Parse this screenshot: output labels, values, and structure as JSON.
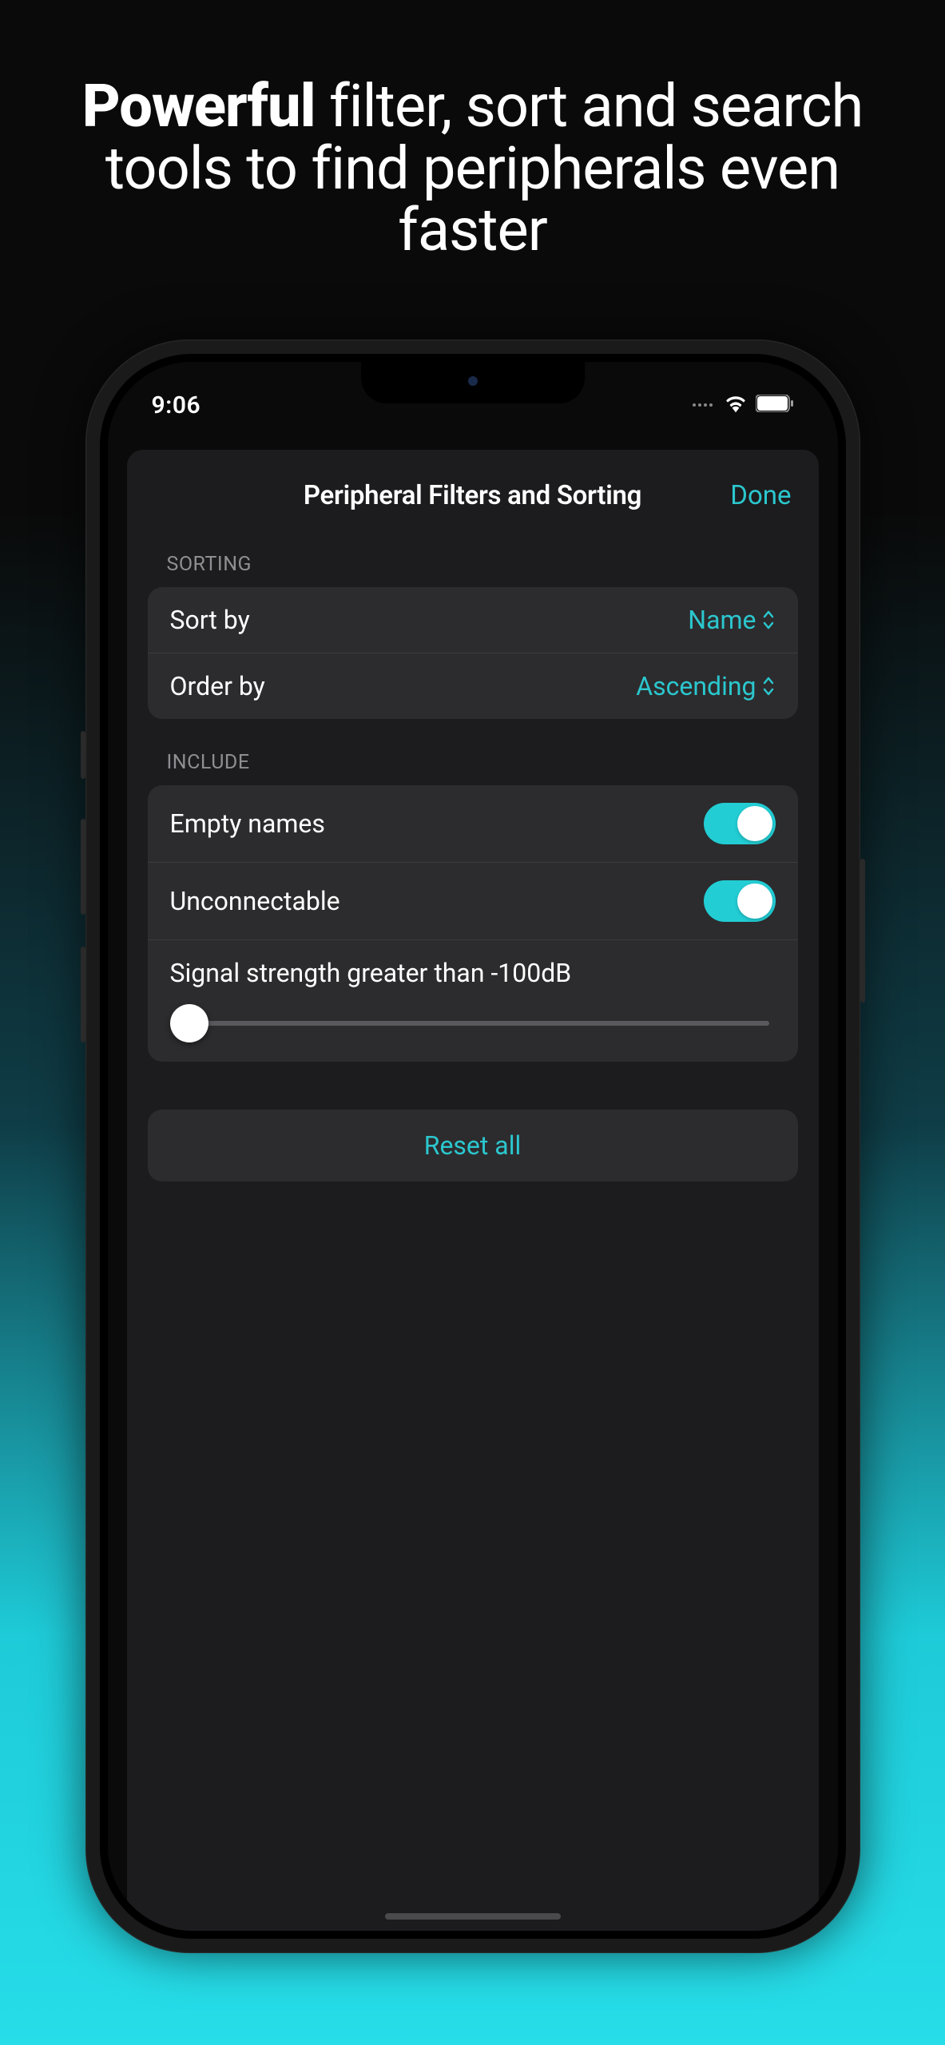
{
  "marketing": {
    "bold": "Powerful",
    "rest": " filter, sort and search tools to find peripherals even faster"
  },
  "status": {
    "time": "9:06"
  },
  "modal": {
    "title": "Peripheral Filters and Sorting",
    "done": "Done"
  },
  "sorting": {
    "header": "SORTING",
    "sortByLabel": "Sort by",
    "sortByValue": "Name",
    "orderByLabel": "Order by",
    "orderByValue": "Ascending"
  },
  "include": {
    "header": "INCLUDE",
    "emptyNames": "Empty names",
    "unconnectable": "Unconnectable",
    "signalLabel": "Signal strength greater than -100dB",
    "signalValue": -100
  },
  "reset": {
    "label": "Reset all"
  },
  "colors": {
    "accent": "#2bc7ce"
  }
}
